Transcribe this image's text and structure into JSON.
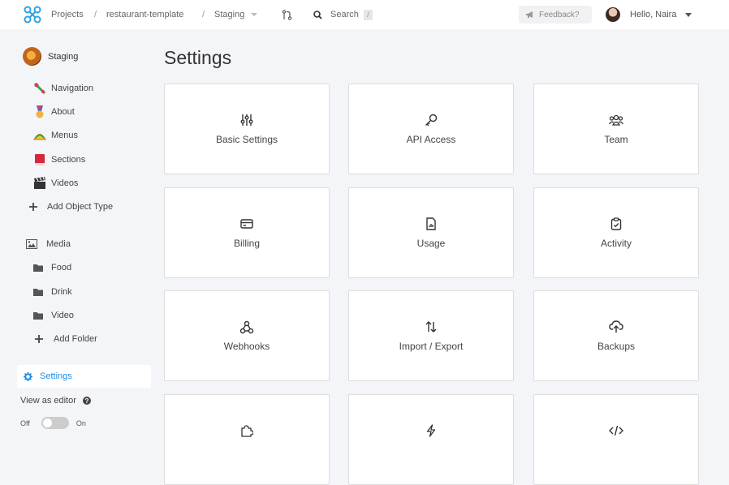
{
  "topbar": {
    "breadcrumbs": [
      "Projects",
      "restaurant-template",
      "Staging"
    ],
    "separator": "/",
    "search_label": "Search",
    "search_shortcut": "/",
    "feedback_label": "Feedback?",
    "user_greeting": "Hello, Naira"
  },
  "sidebar": {
    "project_name": "Staging",
    "object_types": [
      {
        "label": "Navigation",
        "icon": "navigation-icon"
      },
      {
        "label": "About",
        "icon": "medal-icon"
      },
      {
        "label": "Menus",
        "icon": "taco-icon"
      },
      {
        "label": "Sections",
        "icon": "book-icon"
      },
      {
        "label": "Videos",
        "icon": "clapper-icon"
      }
    ],
    "add_object_type": "Add Object Type",
    "media_label": "Media",
    "folders": [
      "Food",
      "Drink",
      "Video"
    ],
    "add_folder": "Add Folder",
    "settings_label": "Settings",
    "view_as_editor": "View as editor",
    "toggle_off": "Off",
    "toggle_on": "On"
  },
  "main": {
    "title": "Settings",
    "cards": [
      {
        "label": "Basic Settings",
        "icon": "sliders-icon"
      },
      {
        "label": "API Access",
        "icon": "key-icon"
      },
      {
        "label": "Team",
        "icon": "team-icon"
      },
      {
        "label": "Billing",
        "icon": "credit-card-icon"
      },
      {
        "label": "Usage",
        "icon": "usage-report-icon"
      },
      {
        "label": "Activity",
        "icon": "clipboard-check-icon"
      },
      {
        "label": "Webhooks",
        "icon": "webhook-icon"
      },
      {
        "label": "Import / Export",
        "icon": "arrows-up-down-icon"
      },
      {
        "label": "Backups",
        "icon": "cloud-upload-icon"
      },
      {
        "label": "",
        "icon": "puzzle-icon"
      },
      {
        "label": "",
        "icon": "lightning-icon"
      },
      {
        "label": "",
        "icon": "code-icon"
      }
    ]
  },
  "colors": {
    "accent": "#1f8ce6",
    "background": "#f4f5f8",
    "card_border": "#dddddd"
  }
}
